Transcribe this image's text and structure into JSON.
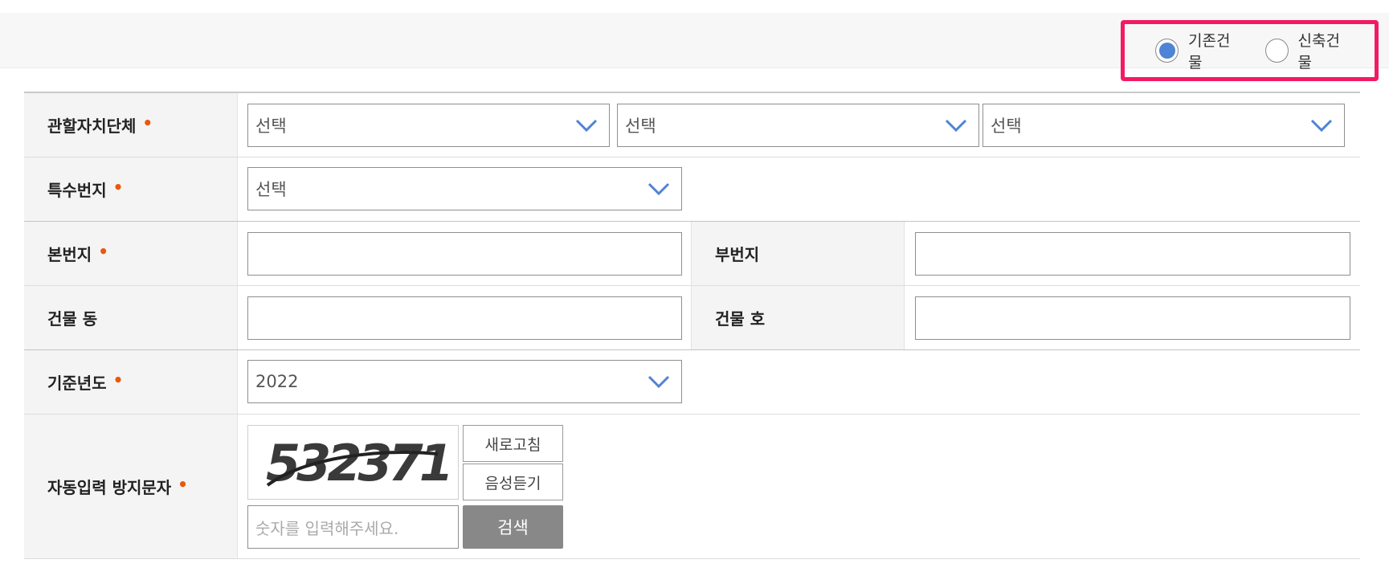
{
  "building_type": {
    "options": [
      {
        "label": "기존건물",
        "selected": true
      },
      {
        "label": "신축건물",
        "selected": false
      }
    ],
    "accent_color": "#4f83d6",
    "highlight_color": "#f21b63"
  },
  "form": {
    "jurisdiction": {
      "label": "관할자치단체",
      "selects": [
        "선택",
        "선택",
        "선택"
      ]
    },
    "special_lot": {
      "label": "특수번지",
      "select": "선택"
    },
    "main_lot": {
      "label": "본번지",
      "value": ""
    },
    "sub_lot": {
      "label": "부번지",
      "value": ""
    },
    "building_dong": {
      "label": "건물 동",
      "value": ""
    },
    "building_ho": {
      "label": "건물 호",
      "value": ""
    },
    "base_year": {
      "label": "기준년도",
      "select": "2022"
    },
    "captcha": {
      "label": "자동입력 방지문자",
      "code": "532371",
      "refresh_label": "새로고침",
      "audio_label": "음성듣기",
      "input_placeholder": "숫자를 입력해주세요.",
      "search_label": "검색"
    },
    "required_mark": "•"
  }
}
